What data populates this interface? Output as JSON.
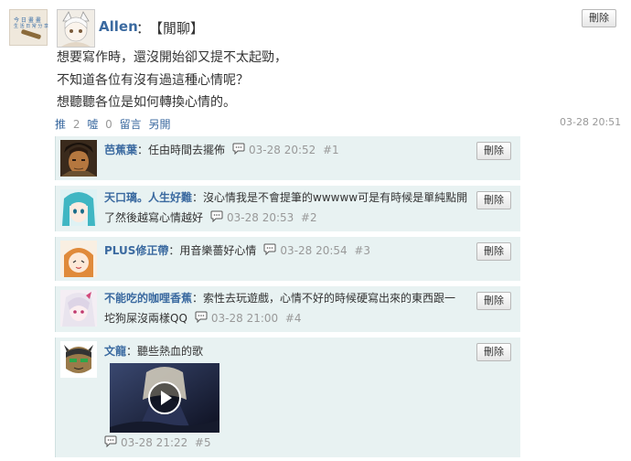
{
  "thumbnail": {
    "line1": "今 日 畫 畫",
    "line2": "生 活 日 常 分 享"
  },
  "post": {
    "author": "Allen",
    "colon": "：",
    "tag": "【閒聊】",
    "delete_label": "刪除",
    "lines": [
      "想要寫作時，還沒開始卻又提不太起勁，",
      "不知道各位有沒有過這種心情呢？",
      "想聽聽各位是如何轉換心情的。"
    ],
    "actions": {
      "push_label": "推",
      "push_count": "2",
      "boo_label": "噓",
      "boo_count": "0",
      "reply_label": "留言",
      "reply_other_label": "另開"
    },
    "time": "03-28 20:51"
  },
  "replies": [
    {
      "name": "芭蕉葉",
      "text": "：任由時間去擺佈",
      "text2": "",
      "time": "03-28 20:52",
      "floor": "#1",
      "delete_label": "刪除"
    },
    {
      "name": "天口璃。人生好難",
      "text": "：沒心情我是不會提筆的wwwww可是有時候是單純點開",
      "text2": "了然後越寫心情越好",
      "time": "03-28 20:53",
      "floor": "#2",
      "delete_label": "刪除"
    },
    {
      "name": "PLUS修正帶",
      "text": "：用音樂薔好心情",
      "text2": "",
      "time": "03-28 20:54",
      "floor": "#3",
      "delete_label": "刪除"
    },
    {
      "name": "不能吃的咖哩香蕉",
      "text": "：索性去玩遊戲，心情不好的時候硬寫出來的東西跟一",
      "text2": "坨狗屎沒兩樣QQ",
      "time": "03-28 21:00",
      "floor": "#4",
      "delete_label": "刪除"
    },
    {
      "name": "文龍",
      "text": "：聽些熱血的歌",
      "text2": "",
      "time": "03-28 21:22",
      "floor": "#5",
      "delete_label": "刪除"
    }
  ],
  "colors": {
    "link": "#3b6aa0",
    "reply_bg": "#e8f2f2",
    "meta": "#999999"
  },
  "icons": [
    "play-icon",
    "comment-bubble-icon"
  ]
}
